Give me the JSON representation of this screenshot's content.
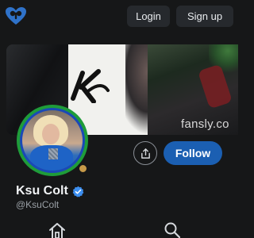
{
  "header": {
    "logo_icon": "fansly-heart-logo-icon",
    "login_label": "Login",
    "signup_label": "Sign up"
  },
  "banner": {
    "watermark": "fansly.co"
  },
  "profile": {
    "display_name": "Ksu Colt",
    "handle": "@KsuColt",
    "verified_icon": "verified-badge-icon",
    "status_icon": "online-status-dot-icon"
  },
  "actions": {
    "share_icon": "share-icon",
    "follow_label": "Follow"
  },
  "bottom_nav": {
    "items": [
      "home-icon",
      "search-icon"
    ]
  },
  "colors": {
    "background": "#161718",
    "accent": "#1b5fb2",
    "header_button": "#26292d",
    "avatar_ring": "#1f9c3a",
    "status_dot": "#c79a49"
  }
}
